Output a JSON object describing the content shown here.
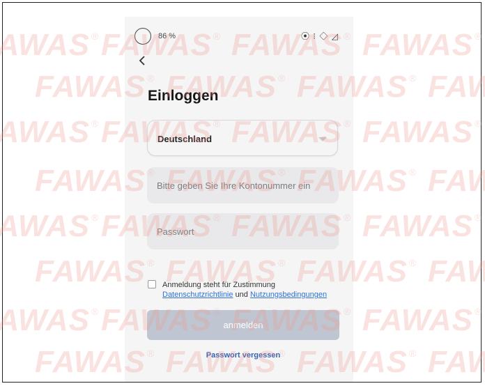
{
  "status_bar": {
    "battery": "86 %",
    "icons": "⦿ ⁝ ◇ ◿"
  },
  "header": {
    "title": "Einloggen"
  },
  "form": {
    "country": "Deutschland",
    "account_placeholder": "Bitte geben Sie Ihre Kontonummer ein",
    "password_placeholder": "Passwort"
  },
  "consent": {
    "line1": "Anmeldung steht für Zustimmung",
    "privacy_link": "Datenschutzrichtlinie",
    "and_text": "und",
    "terms_link": "Nutzungsbedingungen"
  },
  "actions": {
    "login_label": "anmelden",
    "forgot_label": "Passwort vergessen"
  },
  "watermark": {
    "text": "FAWAS",
    "mark": "®"
  },
  "colors": {
    "accent": "#2f73d4",
    "button_disabled": "#bfc6d2",
    "watermark": "#e8968c"
  }
}
